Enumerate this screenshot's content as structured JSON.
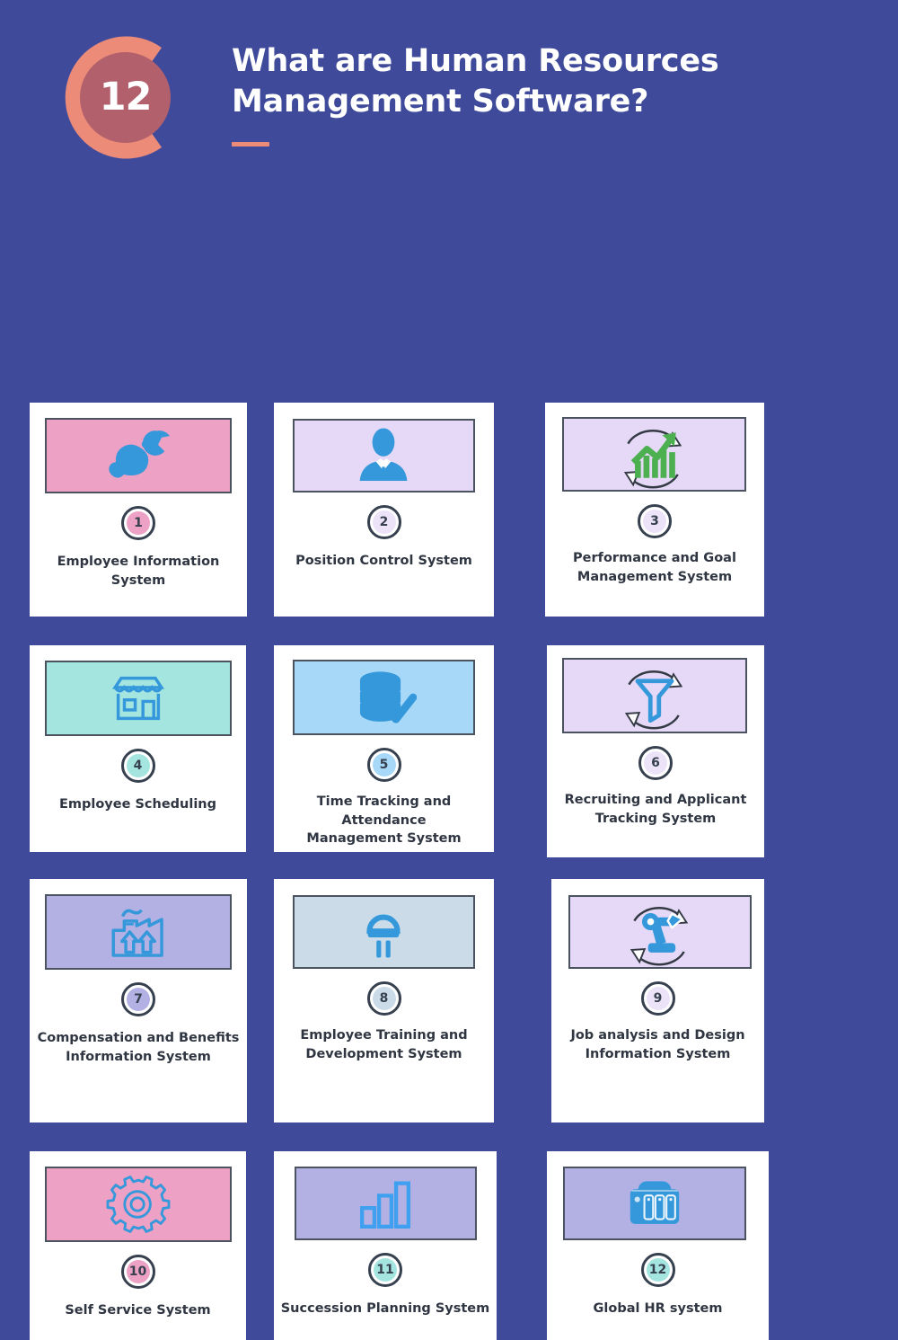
{
  "theme": {
    "background": "#3f4a9a",
    "card_background": "#ffffff",
    "accent_salmon": "#ed8b79",
    "badge_inner": "#b2606c",
    "icon_blue": "#3498db",
    "icon_green": "#4caf50",
    "text_dark": "#2f3642",
    "icon_border": "#4b5360"
  },
  "header": {
    "badge_number": "12",
    "title": "What are Human Resources Management Software?"
  },
  "cards": [
    {
      "number": "1",
      "label": "Employee Information System",
      "icon_name": "fist-wrench-icon",
      "box_color": "#eda1c4",
      "badge_color": "#eda1c4"
    },
    {
      "number": "2",
      "label": "Position Control System",
      "icon_name": "businessman-icon",
      "box_color": "#e5d9f7",
      "badge_color": "#ece3f8"
    },
    {
      "number": "3",
      "label": "Performance and Goal\nManagement System",
      "icon_name": "growth-bar-chart-icon",
      "box_color": "#e5d9f7",
      "badge_color": "#ece3f8"
    },
    {
      "number": "4",
      "label": "Employee Scheduling",
      "icon_name": "storefront-icon",
      "box_color": "#a5e5e0",
      "badge_color": "#a5e5e0"
    },
    {
      "number": "5",
      "label": "Time Tracking and Attendance\nManagement System",
      "icon_name": "database-check-icon",
      "box_color": "#a8d8f8",
      "badge_color": "#a8d8f8"
    },
    {
      "number": "6",
      "label": "Recruiting and Applicant\nTracking System",
      "icon_name": "funnel-rotation-icon",
      "box_color": "#e5d9f7",
      "badge_color": "#ece3f8"
    },
    {
      "number": "7",
      "label": "Compensation and Benefits\nInformation System",
      "icon_name": "factory-arrows-icon",
      "box_color": "#b3b1e3",
      "badge_color": "#b3b1e3"
    },
    {
      "number": "8",
      "label": "Employee Training and\nDevelopment System",
      "icon_name": "led-lamp-icon",
      "box_color": "#cbdce8",
      "badge_color": "#cbdce8"
    },
    {
      "number": "9",
      "label": "Job analysis and Design\nInformation System",
      "icon_name": "robotic-arm-icon",
      "box_color": "#e5d9f7",
      "badge_color": "#ece3f8"
    },
    {
      "number": "10",
      "label": "Self Service System",
      "icon_name": "gear-icon",
      "box_color": "#eda1c4",
      "badge_color": "#eda1c4"
    },
    {
      "number": "11",
      "label": "Succession Planning System",
      "icon_name": "bar-chart-icon",
      "box_color": "#b3b1e3",
      "badge_color": "#a5e5e0"
    },
    {
      "number": "12",
      "label": "Global HR system",
      "icon_name": "server-rack-icon",
      "box_color": "#b3b1e3",
      "badge_color": "#a5e5e0"
    }
  ]
}
